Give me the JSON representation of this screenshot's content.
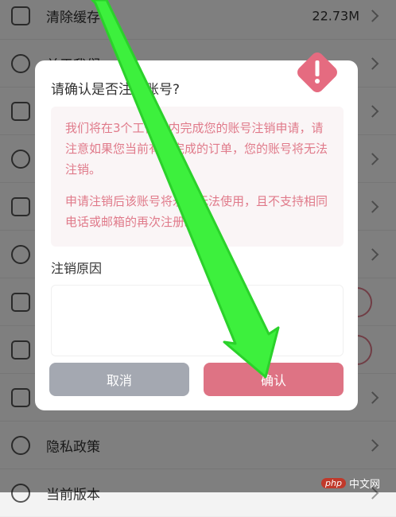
{
  "settings": {
    "rows": [
      {
        "label": "清除缓存",
        "value": "22.73M"
      },
      {
        "label": "关于我们",
        "value": ""
      },
      {
        "label": "",
        "value": ""
      },
      {
        "label": "",
        "value": ""
      },
      {
        "label": "",
        "value": ""
      },
      {
        "label": "",
        "value": ""
      },
      {
        "label": "",
        "value": ""
      },
      {
        "label": "",
        "value": ""
      },
      {
        "label": "",
        "value": ""
      },
      {
        "label": "隐私政策",
        "value": ""
      },
      {
        "label": "当前版本",
        "value": ""
      }
    ]
  },
  "dialog": {
    "title": "请确认是否注销账号?",
    "notice_1": "我们将在3个工作日内完成您的账号注销申请，请注意如果您当前有未完成的订单，您的账号将无法注销。",
    "notice_2": "申请注销后该账号将永久无法使用，且不支持相同电话或邮箱的再次注册。",
    "reason_label": "注销原因",
    "reason_value": "",
    "cancel_label": "取消",
    "confirm_label": "确认",
    "icon": "warning-icon"
  },
  "annotation": {
    "color": "#3df03d"
  },
  "watermark": {
    "brand": "php",
    "text": "中文网"
  }
}
